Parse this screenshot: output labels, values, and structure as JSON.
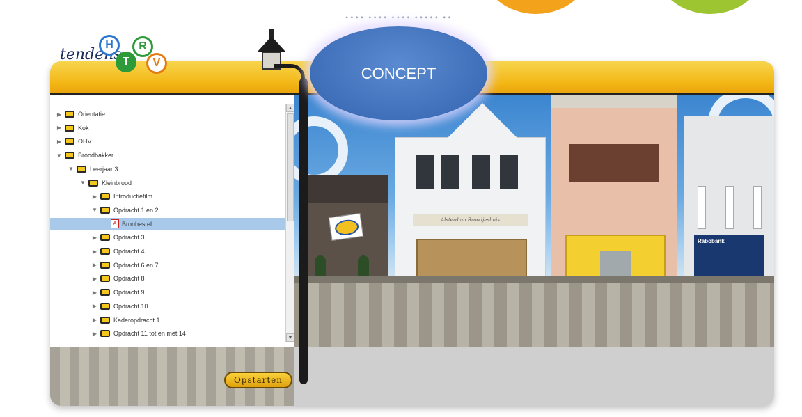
{
  "concept_label": "CONCEPT",
  "logo": {
    "wordmark": "tendens",
    "letters": [
      "H",
      "R",
      "T",
      "V"
    ]
  },
  "tree": [
    {
      "label": "Orientatie",
      "level": 0,
      "expanded": false
    },
    {
      "label": "Kok",
      "level": 0,
      "expanded": false
    },
    {
      "label": "OHV",
      "level": 0,
      "expanded": false
    },
    {
      "label": "Broodbakker",
      "level": 0,
      "expanded": true
    },
    {
      "label": "Leerjaar 3",
      "level": 1,
      "expanded": true
    },
    {
      "label": "Kleinbrood",
      "level": 2,
      "expanded": true
    },
    {
      "label": "Introductiefilm",
      "level": 3,
      "expanded": false
    },
    {
      "label": "Opdracht 1 en 2",
      "level": 3,
      "expanded": true
    },
    {
      "label": "Bronbestel",
      "level": 4,
      "expanded": false,
      "type": "pdf",
      "selected": true
    },
    {
      "label": "Opdracht 3",
      "level": 3,
      "expanded": false
    },
    {
      "label": "Opdracht 4",
      "level": 3,
      "expanded": false
    },
    {
      "label": "Opdracht 6 en 7",
      "level": 3,
      "expanded": false
    },
    {
      "label": "Opdracht 8",
      "level": 3,
      "expanded": false
    },
    {
      "label": "Opdracht 9",
      "level": 3,
      "expanded": false
    },
    {
      "label": "Opdracht 10",
      "level": 3,
      "expanded": false
    },
    {
      "label": "Kaderopdracht 1",
      "level": 3,
      "expanded": false
    },
    {
      "label": "Opdracht 11 tot en met 14",
      "level": 3,
      "expanded": false
    }
  ],
  "scene": {
    "shop_sign": "Alsterdam Broodjeshuis",
    "bank_sign": "Rabobank"
  },
  "start_button": "Opstarten",
  "colors": {
    "header": "#f3b614",
    "accent_orange": "#f3a21c",
    "accent_green": "#9cc531",
    "selection": "#a9c9ea",
    "concept_blue": "#3f6fb9"
  }
}
